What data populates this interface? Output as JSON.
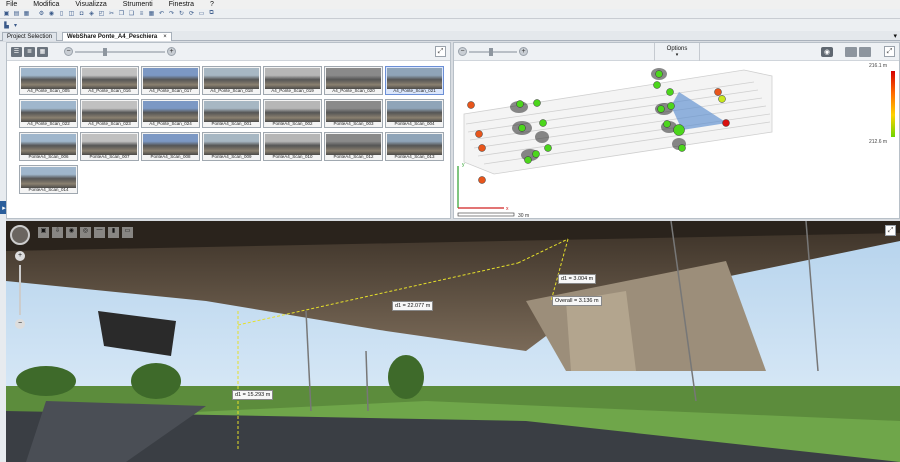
{
  "menu": [
    "File",
    "Modifica",
    "Visualizza",
    "Strumenti",
    "Finestra",
    "?"
  ],
  "tabs": [
    {
      "label": "Project Selection",
      "active": false
    },
    {
      "label": "WebShare Ponte_A4_Peschiera",
      "active": true,
      "close": "×"
    }
  ],
  "scans": [
    "A4_Ponte_Scan_005",
    "A4_Ponte_Scan_016",
    "A4_Ponte_Scan_017",
    "A4_Ponte_Scan_018",
    "A4_Ponte_Scan_019",
    "A4_Ponte_Scan_020",
    "A4_Ponte_Scan_021",
    "A4_Ponte_Scan_022",
    "A4_Ponte_Scan_023",
    "A4_Ponte_Scan_024",
    "PonteA4_Scan_001",
    "PonteA4_Scan_002",
    "PonteA4_Scan_003",
    "PonteA4_Scan_004",
    "PonteA4_Scan_006",
    "PonteA4_Scan_007",
    "PonteA4_Scan_008",
    "PonteA4_Scan_009",
    "PonteA4_Scan_010",
    "PonteA4_Scan_012",
    "PonteA4_Scan_013",
    "PonteA4_Scan_014"
  ],
  "selected_scan": "A4_Ponte_Scan_021",
  "map": {
    "options_label": "Options",
    "legend_max": "216.1 m",
    "legend_min": "212.6 m",
    "scale_label": "30 m",
    "axis_x": "x",
    "axis_y": "y"
  },
  "measurements": {
    "m1": "d1 = 22.077 m",
    "m2": "d1 = 3.004 m",
    "m3": "Overall = 3.136 m",
    "m4": "d1 = 15.293 m"
  },
  "colors": {
    "accent": "#2b5e9b",
    "marker_green": "#4cd61c",
    "marker_orange": "#e8561c",
    "marker_red": "#d81010"
  }
}
